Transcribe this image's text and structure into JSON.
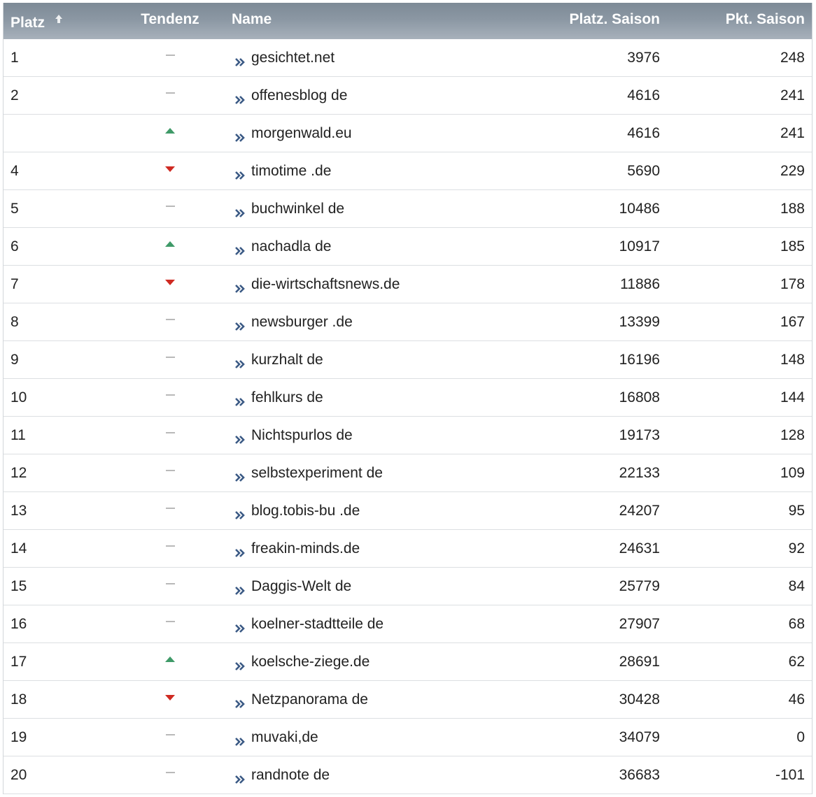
{
  "header": {
    "platz": "Platz",
    "tendenz": "Tendenz",
    "name": "Name",
    "platz_saison": "Platz. Saison",
    "pkt_saison": "Pkt. Saison"
  },
  "colors": {
    "header_bg": "#8b97a3",
    "trend_up": "#3f9a68",
    "trend_down": "#cf2a22",
    "trend_same": "#b9b9b9",
    "link_icon": "#3b5a85"
  },
  "rows": [
    {
      "platz": "1",
      "trend": "same",
      "name": "gesichtet.net",
      "platz_saison": "3976",
      "pkt_saison": "248"
    },
    {
      "platz": "2",
      "trend": "same",
      "name": "offenesblog de",
      "platz_saison": "4616",
      "pkt_saison": "241"
    },
    {
      "platz": "",
      "trend": "up",
      "name": "morgenwald.eu",
      "platz_saison": "4616",
      "pkt_saison": "241"
    },
    {
      "platz": "4",
      "trend": "down",
      "name": "timotime .de",
      "platz_saison": "5690",
      "pkt_saison": "229"
    },
    {
      "platz": "5",
      "trend": "same",
      "name": "buchwinkel de",
      "platz_saison": "10486",
      "pkt_saison": "188"
    },
    {
      "platz": "6",
      "trend": "up",
      "name": "nachadla de",
      "platz_saison": "10917",
      "pkt_saison": "185"
    },
    {
      "platz": "7",
      "trend": "down",
      "name": "die-wirtschaftsnews.de",
      "platz_saison": "11886",
      "pkt_saison": "178"
    },
    {
      "platz": "8",
      "trend": "same",
      "name": "newsburger .de",
      "platz_saison": "13399",
      "pkt_saison": "167"
    },
    {
      "platz": "9",
      "trend": "same",
      "name": "kurzhalt de",
      "platz_saison": "16196",
      "pkt_saison": "148"
    },
    {
      "platz": "10",
      "trend": "same",
      "name": "fehlkurs de",
      "platz_saison": "16808",
      "pkt_saison": "144"
    },
    {
      "platz": "11",
      "trend": "same",
      "name": "Nichtspurlos de",
      "platz_saison": "19173",
      "pkt_saison": "128"
    },
    {
      "platz": "12",
      "trend": "same",
      "name": "selbstexperiment de",
      "platz_saison": "22133",
      "pkt_saison": "109"
    },
    {
      "platz": "13",
      "trend": "same",
      "name": "blog.tobis-bu .de",
      "platz_saison": "24207",
      "pkt_saison": "95"
    },
    {
      "platz": "14",
      "trend": "same",
      "name": "freakin-minds.de",
      "platz_saison": "24631",
      "pkt_saison": "92"
    },
    {
      "platz": "15",
      "trend": "same",
      "name": "Daggis-Welt de",
      "platz_saison": "25779",
      "pkt_saison": "84"
    },
    {
      "platz": "16",
      "trend": "same",
      "name": "koelner-stadtteile de",
      "platz_saison": "27907",
      "pkt_saison": "68"
    },
    {
      "platz": "17",
      "trend": "up",
      "name": "koelsche-ziege.de",
      "platz_saison": "28691",
      "pkt_saison": "62"
    },
    {
      "platz": "18",
      "trend": "down",
      "name": "Netzpanorama de",
      "platz_saison": "30428",
      "pkt_saison": "46"
    },
    {
      "platz": "19",
      "trend": "same",
      "name": "muvaki,de",
      "platz_saison": "34079",
      "pkt_saison": "0"
    },
    {
      "platz": "20",
      "trend": "same",
      "name": "randnote de",
      "platz_saison": "36683",
      "pkt_saison": "-101"
    }
  ]
}
